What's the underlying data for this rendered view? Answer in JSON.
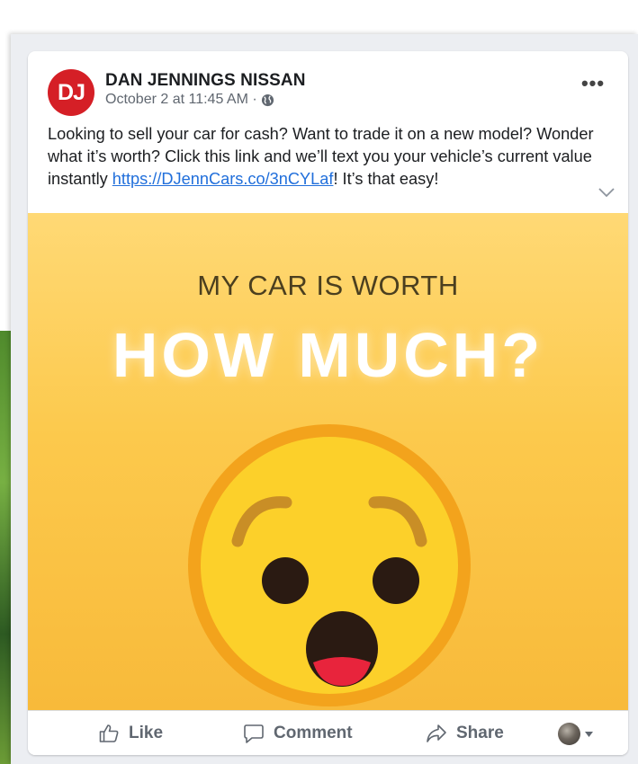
{
  "post": {
    "page_name": "DAN JENNINGS NISSAN",
    "avatar_initials": "DJ",
    "timestamp": "October 2 at 11:45 AM ·",
    "more_label": "•••",
    "text_before_link": "Looking to sell your car for cash? Want to trade it on a new model? Wonder what it’s worth? Click this link and we’ll text you your vehicle’s current value instantly ",
    "link_text": "https://DJennCars.co/3nCYLaf",
    "text_after_link": "! It’s that easy!"
  },
  "image": {
    "subtitle": "MY CAR IS WORTH",
    "headline": "HOW MUCH?"
  },
  "actions": {
    "like": "Like",
    "comment": "Comment",
    "share": "Share"
  },
  "colors": {
    "brand_red": "#d51f26",
    "link_blue": "#216fdb",
    "image_yellow": "#fcc94c"
  },
  "icons": [
    "globe-icon",
    "more-icon",
    "chevron-down-icon",
    "like-icon",
    "comment-icon",
    "share-icon",
    "caret-down-icon"
  ]
}
